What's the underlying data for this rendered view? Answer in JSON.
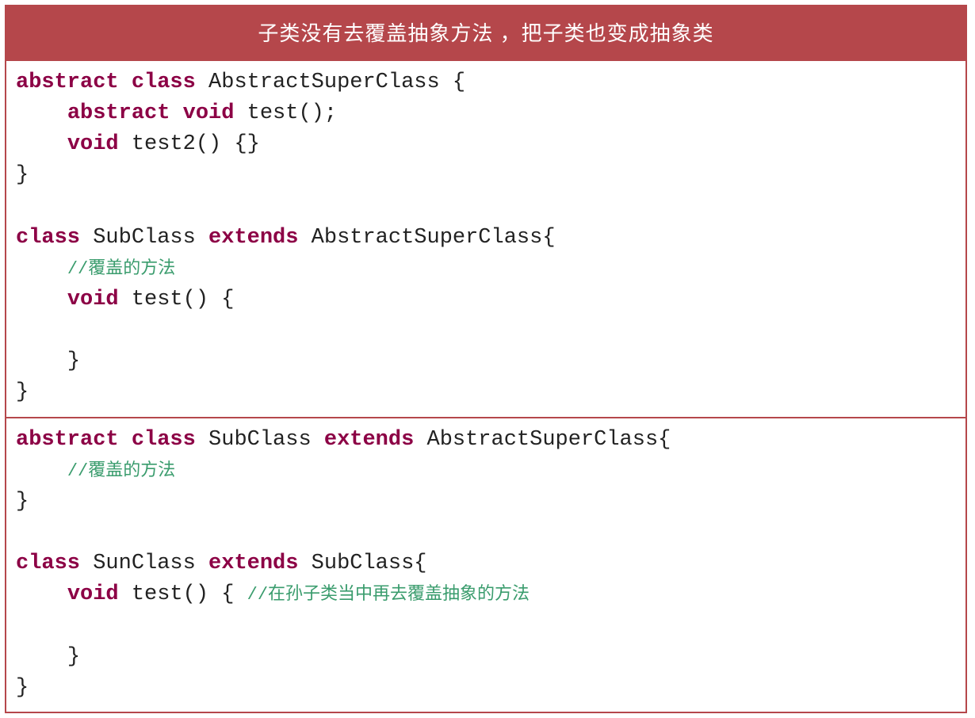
{
  "title": "子类没有去覆盖抽象方法 ，把子类也变成抽象类",
  "colors": {
    "accent": "#b5474b",
    "keyword": "#8c0045",
    "comment": "#3a9c6d"
  },
  "code_top": {
    "tokens": [
      [
        [
          "kw",
          "abstract"
        ],
        [
          "pn",
          " "
        ],
        [
          "kw",
          "class"
        ],
        [
          "pn",
          " "
        ],
        [
          "id",
          "AbstractSuperClass {"
        ]
      ],
      [
        [
          "pn",
          "    "
        ],
        [
          "kw",
          "abstract"
        ],
        [
          "pn",
          " "
        ],
        [
          "kw",
          "void"
        ],
        [
          "pn",
          " "
        ],
        [
          "id",
          "test();"
        ]
      ],
      [
        [
          "pn",
          "    "
        ],
        [
          "kw",
          "void"
        ],
        [
          "pn",
          " "
        ],
        [
          "id",
          "test2() {}"
        ]
      ],
      [
        [
          "id",
          "}"
        ]
      ],
      [
        [
          "pn",
          ""
        ]
      ],
      [
        [
          "kw",
          "class"
        ],
        [
          "pn",
          " "
        ],
        [
          "id",
          "SubClass "
        ],
        [
          "kw",
          "extends"
        ],
        [
          "pn",
          " "
        ],
        [
          "id",
          "AbstractSuperClass{"
        ]
      ],
      [
        [
          "pn",
          "    "
        ],
        [
          "cm",
          "//覆盖的方法"
        ]
      ],
      [
        [
          "pn",
          "    "
        ],
        [
          "kw",
          "void"
        ],
        [
          "pn",
          " "
        ],
        [
          "id",
          "test() {"
        ]
      ],
      [
        [
          "pn",
          ""
        ]
      ],
      [
        [
          "pn",
          "    "
        ],
        [
          "id",
          "}"
        ]
      ],
      [
        [
          "id",
          "}"
        ]
      ]
    ]
  },
  "code_bottom": {
    "tokens": [
      [
        [
          "kw",
          "abstract"
        ],
        [
          "pn",
          " "
        ],
        [
          "kw",
          "class"
        ],
        [
          "pn",
          " "
        ],
        [
          "id",
          "SubClass "
        ],
        [
          "kw",
          "extends"
        ],
        [
          "pn",
          " "
        ],
        [
          "id",
          "AbstractSuperClass{"
        ]
      ],
      [
        [
          "pn",
          "    "
        ],
        [
          "cm",
          "//覆盖的方法"
        ]
      ],
      [
        [
          "id",
          "}"
        ]
      ],
      [
        [
          "pn",
          ""
        ]
      ],
      [
        [
          "kw",
          "class"
        ],
        [
          "pn",
          " "
        ],
        [
          "id",
          "SunClass "
        ],
        [
          "kw",
          "extends"
        ],
        [
          "pn",
          " "
        ],
        [
          "id",
          "SubClass{"
        ]
      ],
      [
        [
          "pn",
          "    "
        ],
        [
          "kw",
          "void"
        ],
        [
          "pn",
          " "
        ],
        [
          "id",
          "test() { "
        ],
        [
          "cm",
          "//在孙子类当中再去覆盖抽象的方法"
        ]
      ],
      [
        [
          "pn",
          ""
        ]
      ],
      [
        [
          "pn",
          "    "
        ],
        [
          "id",
          "}"
        ]
      ],
      [
        [
          "id",
          "}"
        ]
      ]
    ]
  }
}
